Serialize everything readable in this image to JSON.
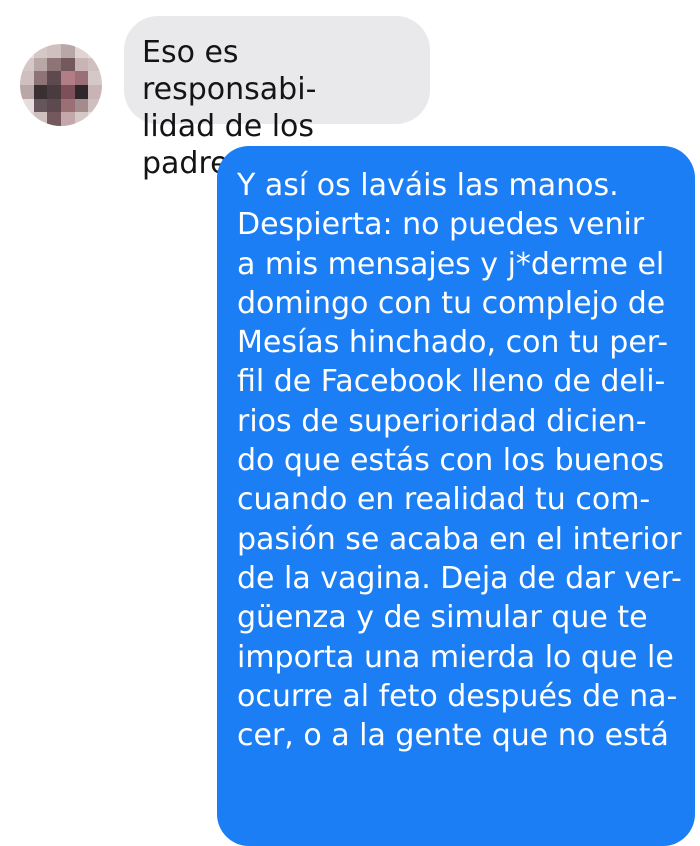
{
  "colors": {
    "background": "#ffffff",
    "incoming_bubble": "#e9e9eb",
    "outgoing_bubble": "#1c7ef4",
    "incoming_text": "#141414",
    "outgoing_text": "#ffffff"
  },
  "messages": [
    {
      "direction": "incoming",
      "text": "Eso es responsabi-\nlidad de los padres"
    },
    {
      "direction": "outgoing",
      "text": "Y así os laváis las manos.\nDespierta: no puedes venir\na mis mensajes y j*derme el\ndomingo con tu complejo de\nMesías hinchado, con tu per-\nfil de Facebook lleno de deli-\nrios de superioridad dicien-\ndo que estás con los buenos\ncuando en realidad tu com-\npasión se acaba en el interior\nde la vagina. Deja de dar ver-\ngüenza y de simular que te\nimporta una mierda lo que le\nocurre al feto después de na-\ncer, o a la gente que no está"
    }
  ]
}
